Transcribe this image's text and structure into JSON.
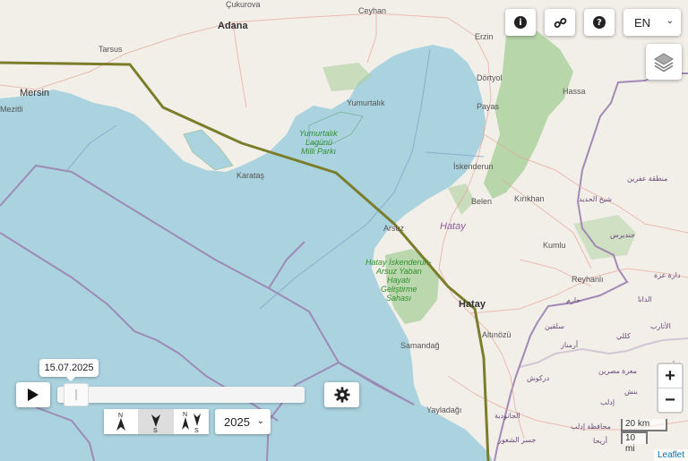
{
  "map": {
    "places": {
      "cukurova": "Çukurova",
      "ceyhan": "Ceyhan",
      "adana": "Adana",
      "tarsus": "Tarsus",
      "mersin": "Mersin",
      "mezitli": "Mezitli",
      "yumurtalik": "Yumurtalık",
      "erzin": "Erzin",
      "dortyol": "Dörtyol",
      "payas": "Payas",
      "hassa": "Hassa",
      "iskenderun": "İskenderun",
      "karatas": "Karataş",
      "belen": "Belen",
      "kirikhan": "Kırıkhan",
      "arsuz": "Arsuz",
      "kumlu": "Kumlu",
      "reyhanli": "Reyhanlı",
      "hatay_city": "Hatay",
      "samandag": "Samandağ",
      "altinozu": "Altınözü",
      "yayladagi": "Yayladağı",
      "hatay_region": "Hatay"
    },
    "parks": {
      "yumurtalik_1": "Yumurtalık",
      "yumurtalik_2": "Lagünü",
      "yumurtalik_3": "Milli Parkı",
      "arsuz_1": "Hatay İskenderun-",
      "arsuz_2": "Arsuz Yaban",
      "arsuz_3": "Hayatı",
      "arsuz_4": "Geliştirme",
      "arsuz_5": "Sahası"
    },
    "arabic": {
      "a1": "منطقة عفرين",
      "a2": "شيخ الحديد",
      "a3": "جنديرس",
      "a4": "دارة عزة",
      "a5": "حارم",
      "a6": "الدانا",
      "a7": "سلقين",
      "a8": "الأتارب",
      "a9": "أرمناز",
      "a10": "كللي",
      "a11": "معرة مصرين",
      "a12": "دركوش",
      "a13": "بنش",
      "a14": "إدلب",
      "a15": "محافظة إدلب",
      "a16": "الجانودية",
      "a17": "جسر الشغور",
      "a18": "أريحا",
      "a19": "سان"
    }
  },
  "controls": {
    "info_icon": "info-icon",
    "link_icon": "link-icon",
    "help_icon": "help-icon",
    "language": "EN",
    "layers_icon": "layers-icon",
    "zoom_in": "+",
    "zoom_out": "−",
    "scale_km": "20 km",
    "scale_mi": "10 mi",
    "attribution": "Leaflet"
  },
  "timeline": {
    "date_label": "15.07.2025",
    "progress": 0.02,
    "play_icon": "play-icon",
    "settings_icon": "gear-icon",
    "year": "2025",
    "orientation": {
      "n": "N",
      "s": "S",
      "active": 1
    }
  },
  "colors": {
    "sea": "#aad3df",
    "land": "#f2efe9",
    "route": "#7b7d2a",
    "forest": "#add19e",
    "border": "#9b7fb0"
  }
}
